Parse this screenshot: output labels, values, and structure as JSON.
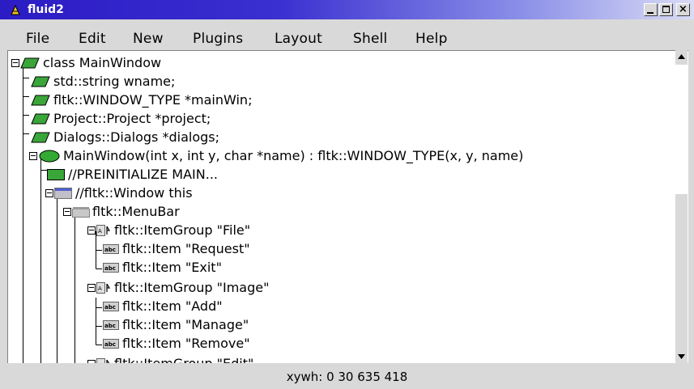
{
  "window": {
    "title": "fluid2",
    "minimize_label": "_",
    "maximize_label": "□",
    "close_label": "×"
  },
  "menu": [
    "File",
    "Edit",
    "New",
    "Plugins",
    "Layout",
    "Shell",
    "Help"
  ],
  "tree": {
    "items": [
      {
        "label": "class MainWindow",
        "icon": "class-icon"
      },
      {
        "label": "std::string wname;",
        "icon": "declaration-icon"
      },
      {
        "label": "fltk::WINDOW_TYPE *mainWin;",
        "icon": "declaration-icon"
      },
      {
        "label": "Project::Project *project;",
        "icon": "declaration-icon"
      },
      {
        "label": "Dialogs::Dialogs *dialogs;",
        "icon": "declaration-icon"
      },
      {
        "label": "MainWindow(int x, int y, char *name) : fltk::WINDOW_TYPE(x, y, name)",
        "icon": "function-icon"
      },
      {
        "label": "//PREINITIALIZE MAIN...",
        "icon": "code-icon"
      },
      {
        "label": "//fltk::Window this",
        "icon": "window-icon"
      },
      {
        "label": "fltk::MenuBar",
        "icon": "menubar-icon"
      },
      {
        "label": "fltk::ItemGroup \"File\"",
        "icon": "itemgroup-icon"
      },
      {
        "label": "fltk::Item \"Request\"",
        "icon": "item-icon"
      },
      {
        "label": "fltk::Item \"Exit\"",
        "icon": "item-icon"
      },
      {
        "label": "fltk::ItemGroup \"Image\"",
        "icon": "itemgroup-icon"
      },
      {
        "label": "fltk::Item \"Add\"",
        "icon": "item-icon"
      },
      {
        "label": "fltk::Item \"Manage\"",
        "icon": "item-icon"
      },
      {
        "label": "fltk::Item \"Remove\"",
        "icon": "item-icon"
      },
      {
        "label": "fltk::ItemGroup \"Edit\"",
        "icon": "itemgroup-icon"
      }
    ],
    "item_icon_text": "abc"
  },
  "status": {
    "text": "xywh: 0 30 635 418"
  },
  "colors": {
    "title_bar": "#2b1cc4",
    "declaration": "#3aa63a",
    "function": "#33aa33",
    "window": "#5060d0"
  }
}
